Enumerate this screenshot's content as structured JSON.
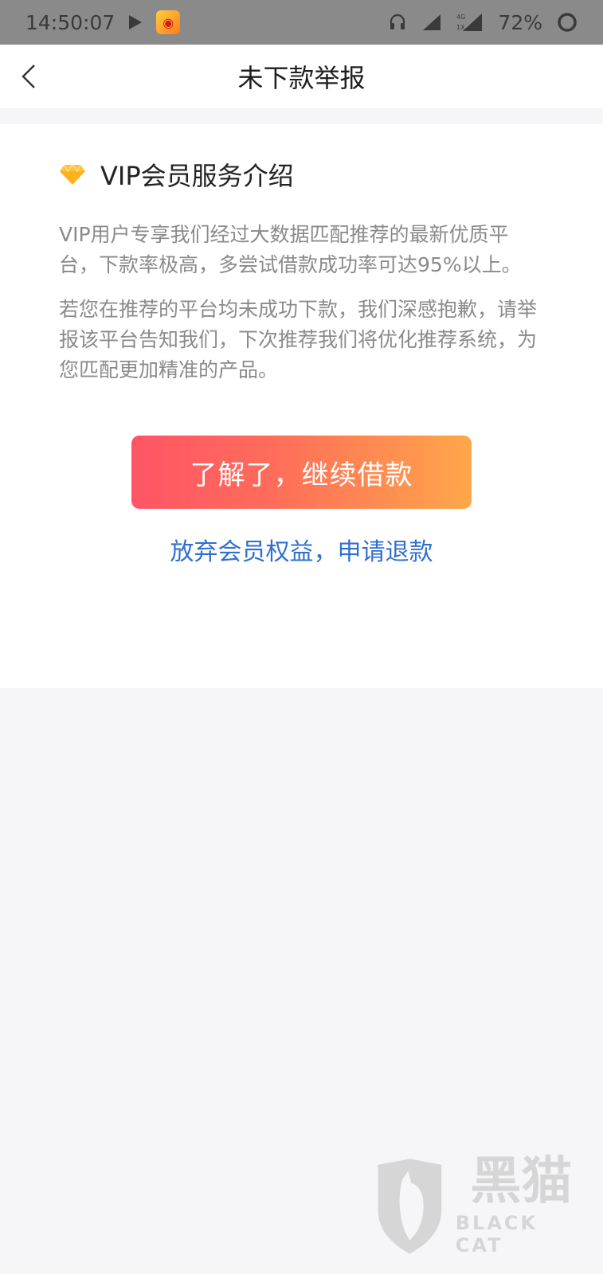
{
  "status_bar": {
    "time": "14:50:07",
    "battery": "72%",
    "network": "4G",
    "signal_sub": "1X"
  },
  "nav": {
    "title": "未下款举报",
    "back_icon": "chevron-left-icon"
  },
  "intro": {
    "icon": "diamond-icon",
    "title": "VIP会员服务介绍",
    "paragraph1": "VIP用户专享我们经过大数据匹配推荐的最新优质平台，下款率极高，多尝试借款成功率可达95%以上。",
    "paragraph2": "若您在推荐的平台均未成功下款，我们深感抱歉，请举报该平台告知我们，下次推荐我们将优化推荐系统，为您匹配更加精准的产品。"
  },
  "actions": {
    "continue_label": "了解了，继续借款",
    "refund_label": "放弃会员权益，申请退款"
  },
  "watermark": {
    "cn": "黑猫",
    "en": "BLACK CAT"
  },
  "colors": {
    "button_start": "#ff5566",
    "button_end": "#ffa74a",
    "link": "#2f6fcf",
    "diamond": "#ffc23a"
  }
}
